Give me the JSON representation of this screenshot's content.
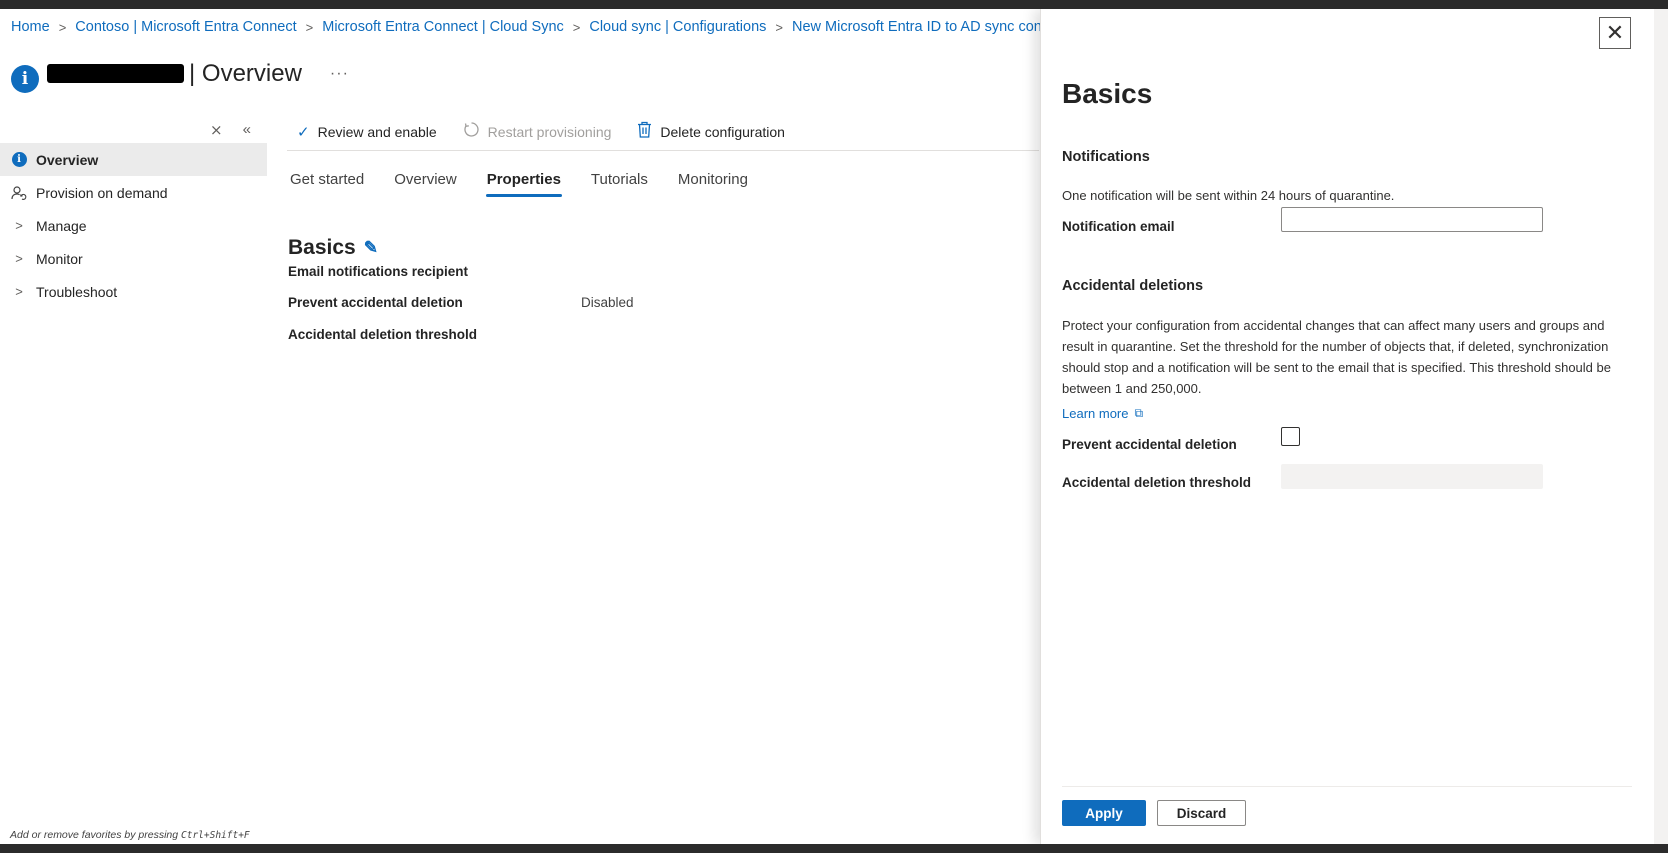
{
  "breadcrumb": [
    "Home",
    "Contoso | Microsoft Entra Connect",
    "Microsoft Entra Connect | Cloud Sync",
    "Cloud sync | Configurations",
    "New Microsoft Entra ID to AD sync confi"
  ],
  "header": {
    "title": "| Overview",
    "more": "···"
  },
  "sidebar": {
    "items": [
      {
        "label": "Overview",
        "icon": "info-icon",
        "active": true
      },
      {
        "label": "Provision on demand",
        "icon": "user-sync-icon"
      },
      {
        "label": "Manage",
        "icon": "chevron-right-icon"
      },
      {
        "label": "Monitor",
        "icon": "chevron-right-icon"
      },
      {
        "label": "Troubleshoot",
        "icon": "chevron-right-icon"
      }
    ]
  },
  "toolbar": {
    "review": "Review and enable",
    "restart": "Restart provisioning",
    "delete": "Delete configuration"
  },
  "tabs": [
    "Get started",
    "Overview",
    "Properties",
    "Tutorials",
    "Monitoring"
  ],
  "active_tab": "Properties",
  "basics": {
    "heading": "Basics",
    "rows": [
      {
        "label": "Email notifications recipient",
        "value": ""
      },
      {
        "label": "Prevent accidental deletion",
        "value": "Disabled"
      },
      {
        "label": "Accidental deletion threshold",
        "value": ""
      }
    ]
  },
  "footer": {
    "hint": "Add or remove favorites by pressing",
    "shortcut": "Ctrl+Shift+F"
  },
  "panel": {
    "title": "Basics",
    "notifications_heading": "Notifications",
    "notifications_text": "One notification will be sent within 24 hours of quarantine.",
    "notification_email_label": "Notification email",
    "notification_email_value": "",
    "accidental_heading": "Accidental deletions",
    "accidental_text": "Protect your configuration from accidental changes that can affect many users and groups and result in quarantine. Set the threshold for the number of objects that, if deleted, synchronization should stop and a notification will be sent to the email that is specified. This threshold should be between 1 and 250,000.",
    "learn_more": "Learn more",
    "prevent_label": "Prevent accidental deletion",
    "prevent_checked": false,
    "threshold_label": "Accidental deletion threshold",
    "threshold_value": "",
    "apply": "Apply",
    "discard": "Discard"
  },
  "colors": {
    "accent": "#0f6cbd",
    "text": "#242424",
    "disabled": "#a19f9d"
  }
}
